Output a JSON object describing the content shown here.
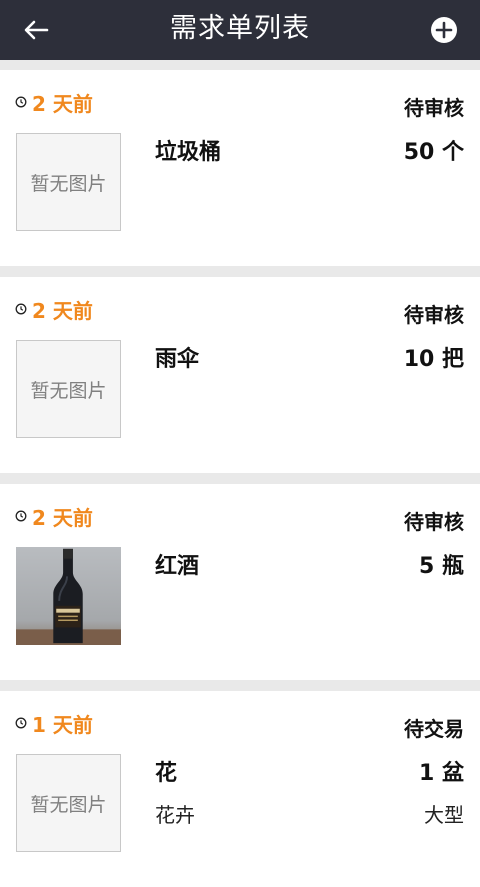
{
  "header": {
    "title": "需求单列表",
    "back_icon": "arrow-left-icon",
    "add_icon": "plus-circle-icon"
  },
  "colors": {
    "header_bg": "#2d2f3a",
    "accent": "#f0881e"
  },
  "items": [
    {
      "time": "2 天前",
      "status": "待审核",
      "name": "垃圾桶",
      "qty": "50 个",
      "image_placeholder": "暂无图片"
    },
    {
      "time": "2 天前",
      "status": "待审核",
      "name": "雨伞",
      "qty": "10 把",
      "image_placeholder": "暂无图片"
    },
    {
      "time": "2 天前",
      "status": "待审核",
      "name": "红酒",
      "qty": "5 瓶",
      "image": "wine-bottle-photo"
    },
    {
      "time": "1 天前",
      "status": "待交易",
      "name": "花",
      "qty": "1 盆",
      "sub_name": "花卉",
      "sub_size": "大型",
      "image_placeholder": "暂无图片"
    }
  ]
}
